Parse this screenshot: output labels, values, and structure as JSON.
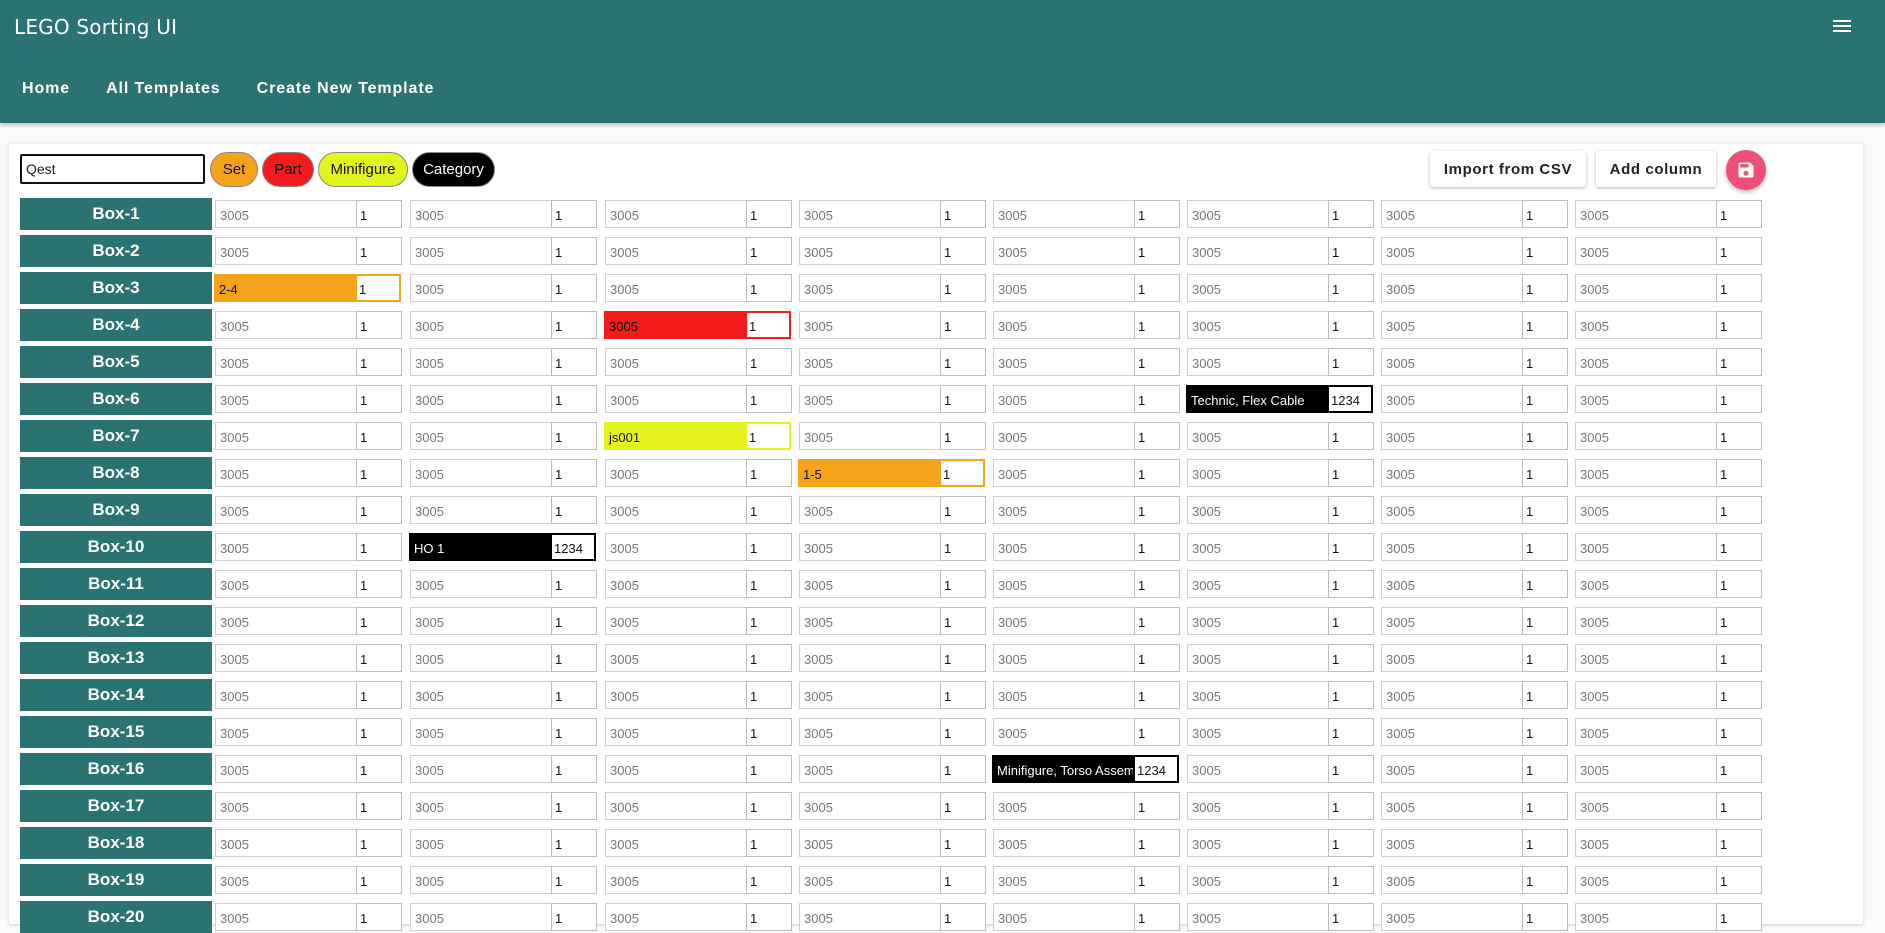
{
  "app": {
    "title": "LEGO Sorting UI"
  },
  "nav": [
    "Home",
    "All Templates",
    "Create New Template"
  ],
  "template": {
    "name": "Qest"
  },
  "chips": [
    {
      "label": "Set",
      "color": "#f5a31a",
      "text_color": "#111111"
    },
    {
      "label": "Part",
      "color": "#f31b1b",
      "text_color": "#111111"
    },
    {
      "label": "Minifigure",
      "color": "#e4f31b",
      "text_color": "#111111"
    },
    {
      "label": "Category",
      "color": "#000000",
      "text_color": "#ffffff"
    }
  ],
  "buttons": {
    "import": "Import from CSV",
    "add_column": "Add column",
    "save_icon": "save-icon"
  },
  "colors": {
    "teal": "#2b7272",
    "save": "#ee4f79"
  },
  "defaults": {
    "code": "3005",
    "qty": "1"
  },
  "rows": [
    {
      "label": "Box-1"
    },
    {
      "label": "Box-2"
    },
    {
      "label": "Box-3",
      "overrides": {
        "0": {
          "code": "2-4",
          "qty": "1",
          "type": "set"
        }
      }
    },
    {
      "label": "Box-4",
      "overrides": {
        "2": {
          "code": "3005",
          "qty": "1",
          "type": "part"
        }
      }
    },
    {
      "label": "Box-5"
    },
    {
      "label": "Box-6",
      "overrides": {
        "5": {
          "code": "Technic, Flex Cable",
          "qty": "1234",
          "type": "category"
        }
      }
    },
    {
      "label": "Box-7",
      "overrides": {
        "2": {
          "code": "js001",
          "qty": "1",
          "type": "minifigure"
        }
      }
    },
    {
      "label": "Box-8",
      "overrides": {
        "3": {
          "code": "1-5",
          "qty": "1",
          "type": "set"
        }
      }
    },
    {
      "label": "Box-9"
    },
    {
      "label": "Box-10",
      "overrides": {
        "1": {
          "code": "HO 1",
          "qty": "1234",
          "type": "category"
        }
      }
    },
    {
      "label": "Box-11"
    },
    {
      "label": "Box-12"
    },
    {
      "label": "Box-13"
    },
    {
      "label": "Box-14"
    },
    {
      "label": "Box-15"
    },
    {
      "label": "Box-16",
      "overrides": {
        "4": {
          "code": "Minifigure, Torso Assembly",
          "qty": "1234",
          "type": "category"
        }
      }
    },
    {
      "label": "Box-17"
    },
    {
      "label": "Box-18"
    },
    {
      "label": "Box-19"
    },
    {
      "label": "Box-20"
    }
  ]
}
